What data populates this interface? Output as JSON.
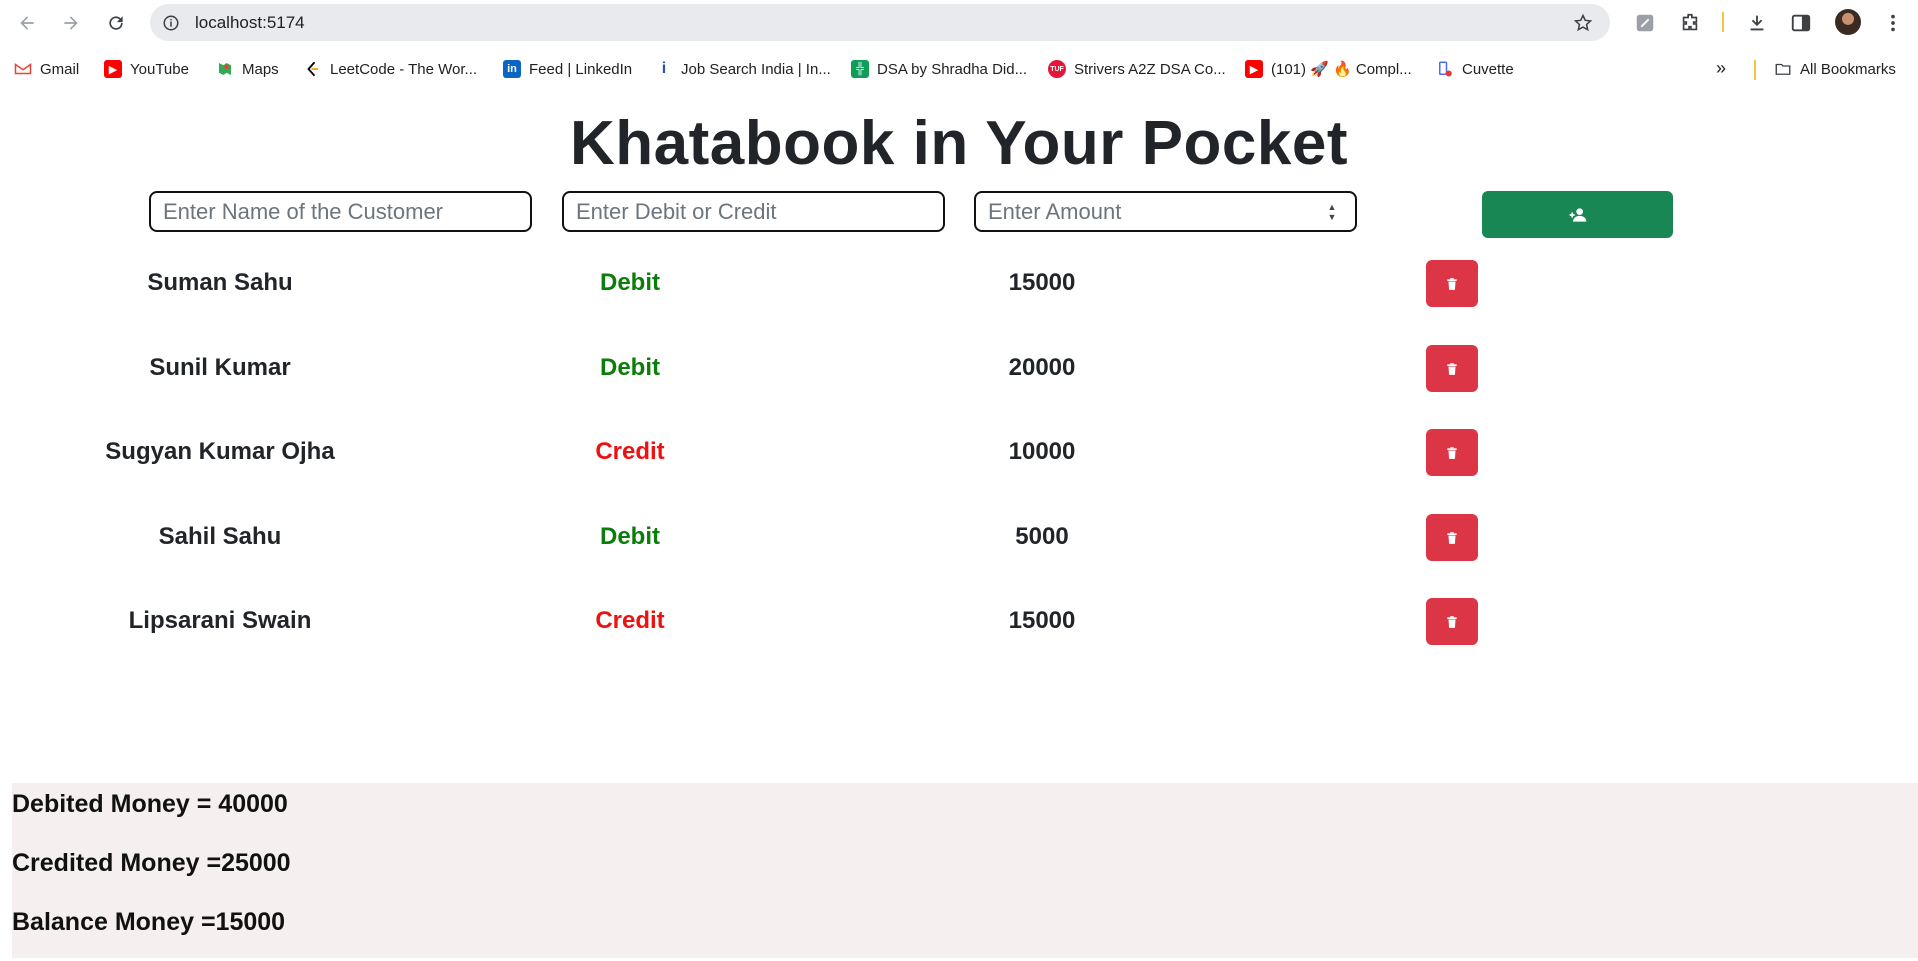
{
  "browser": {
    "url": "localhost:5174",
    "bookmarks": [
      {
        "label": "Gmail",
        "icon": "gmail-icon"
      },
      {
        "label": "YouTube",
        "icon": "youtube-icon"
      },
      {
        "label": "Maps",
        "icon": "maps-icon"
      },
      {
        "label": "LeetCode - The Wor...",
        "icon": "leetcode-icon"
      },
      {
        "label": "Feed | LinkedIn",
        "icon": "linkedin-icon"
      },
      {
        "label": "Job Search India | In...",
        "icon": "indeed-icon"
      },
      {
        "label": "DSA by Shradha Did...",
        "icon": "sheets-icon"
      },
      {
        "label": "Strivers A2Z DSA Co...",
        "icon": "tuf-icon"
      },
      {
        "label": "(101) 🚀 🔥 Compl...",
        "icon": "youtube-icon"
      },
      {
        "label": "Cuvette",
        "icon": "cuvette-icon"
      }
    ],
    "all_bookmarks": "All Bookmarks"
  },
  "app": {
    "title": "Khatabook in Your Pocket",
    "form": {
      "name_placeholder": "Enter Name of the Customer",
      "type_placeholder": "Enter Debit or Credit",
      "amount_placeholder": "Enter Amount",
      "add_icon": "add-user-icon"
    },
    "entries": [
      {
        "name": "Suman Sahu",
        "type": "Debit",
        "amount": "15000"
      },
      {
        "name": "Sunil Kumar",
        "type": "Debit",
        "amount": "20000"
      },
      {
        "name": "Sugyan Kumar Ojha",
        "type": "Credit",
        "amount": "10000"
      },
      {
        "name": "Sahil Sahu",
        "type": "Debit",
        "amount": "5000"
      },
      {
        "name": "Lipsarani Swain",
        "type": "Credit",
        "amount": "15000"
      }
    ],
    "summary": {
      "debited": "Debited Money = 40000",
      "credited": "Credited Money =25000",
      "balance": "Balance Money =15000"
    },
    "colors": {
      "debit": "#0a7d0a",
      "credit": "#ee1111",
      "add_button": "#198754",
      "delete_button": "#dc3545"
    }
  }
}
